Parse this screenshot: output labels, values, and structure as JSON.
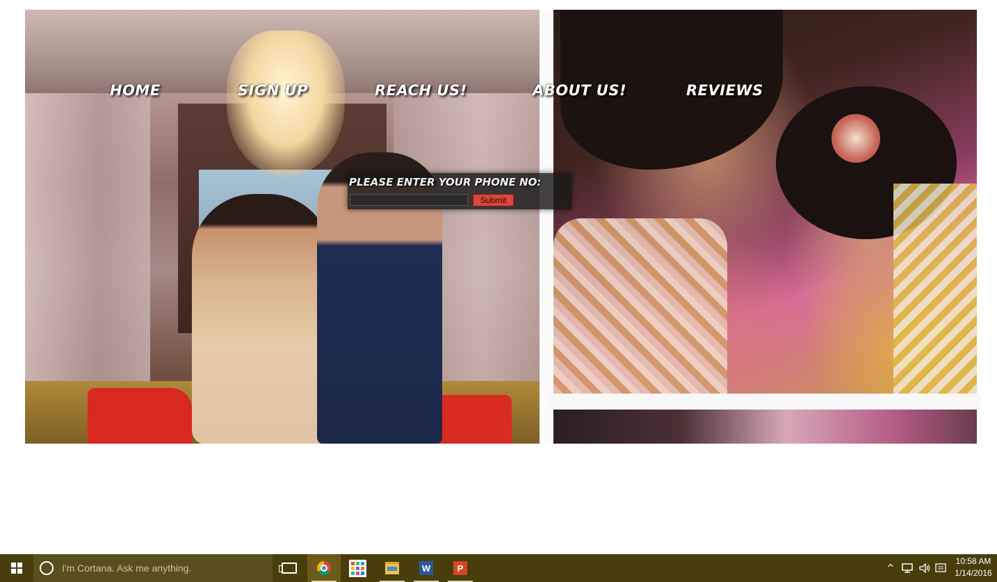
{
  "nav": {
    "home": "HOME",
    "signup": "SIGN UP",
    "reach": "REACH US!",
    "about": "ABOUT US!",
    "reviews": "REVIEWS"
  },
  "phone_form": {
    "label": "PLEASE ENTER YOUR PHONE NO:",
    "input_value": "",
    "submit_label": "Submit"
  },
  "taskbar": {
    "cortana_placeholder": "I'm Cortana. Ask me anything.",
    "apps": [
      "task-view",
      "chrome",
      "store",
      "file-explorer",
      "word",
      "powerpoint"
    ],
    "active_app": "chrome",
    "word_letter": "W",
    "ppt_letter": "P",
    "tray_chevron": "^",
    "clock_time": "10:58 AM",
    "clock_date": "1/14/2016"
  },
  "colors": {
    "taskbar_bg": "#4a3d0c",
    "cortana_bg": "#5b4e1e",
    "submit_bg": "#d9473a",
    "phone_box_bg": "#191919"
  }
}
